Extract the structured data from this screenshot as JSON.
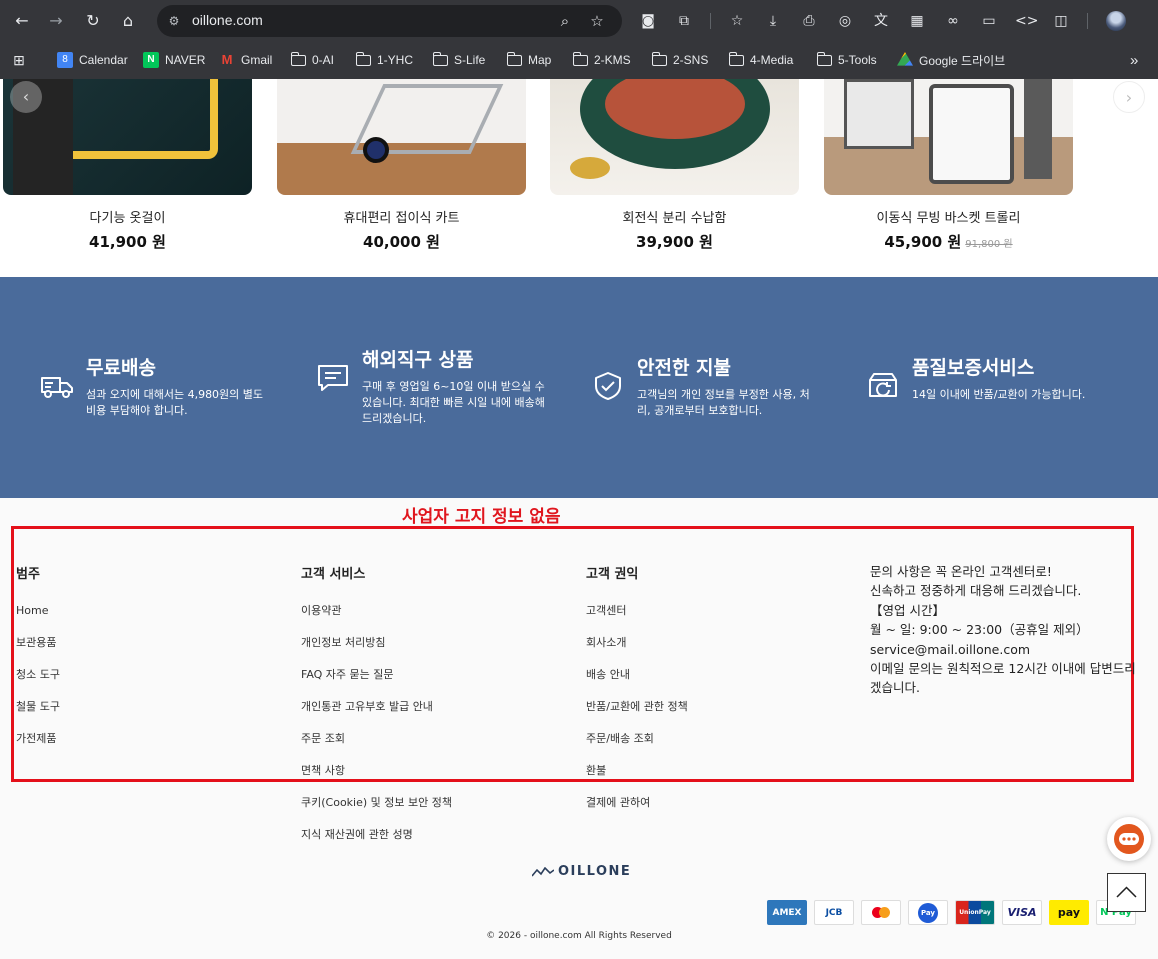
{
  "browser": {
    "url": "oillone.com",
    "bookmarks": [
      "Calendar",
      "NAVER",
      "Gmail",
      "0-AI",
      "1-YHC",
      "S-Life",
      "Map",
      "2-KMS",
      "2-SNS",
      "4-Media",
      "5-Tools",
      "Google 드라이브"
    ],
    "calendar_day": "8",
    "naver_letter": "N",
    "gmail_letter": "M"
  },
  "products": [
    {
      "name": "다기능 옷걸이",
      "price": "41,900 원",
      "old_price": ""
    },
    {
      "name": "휴대편리 접이식 카트",
      "price": "40,000 원",
      "old_price": ""
    },
    {
      "name": "회전식 분리 수납함",
      "price": "39,900 원",
      "old_price": ""
    },
    {
      "name": "이동식 무빙 바스켓 트롤리",
      "price": "45,900 원",
      "old_price": "91,800 원"
    }
  ],
  "features": [
    {
      "title": "무료배송",
      "desc": "섬과 오지에 대해서는 4,980원의 별도 비용 부담해야 합니다.",
      "icon": "truck-icon"
    },
    {
      "title": "해외직구 상품",
      "desc": "구매 후 영업일 6~10일 이내 받으실 수 있습니다. 최대한 빠른 시일 내에 배송해 드리겠습니다.",
      "icon": "chat-icon"
    },
    {
      "title": "안전한 지불",
      "desc": "고객님의 개인 정보를 부정한 사용, 처리, 공개로부터 보호합니다.",
      "icon": "shield-check-icon"
    },
    {
      "title": "품질보증서비스",
      "desc": "14일 이내에 반품/교환이 가능합니다.",
      "icon": "return-box-icon"
    }
  ],
  "annotation": "사업자 고지 정보 없음",
  "footer": {
    "columns": [
      {
        "heading": "범주",
        "links": [
          "Home",
          "보관용품",
          "청소 도구",
          "철물 도구",
          "가전제품"
        ]
      },
      {
        "heading": "고객 서비스",
        "links": [
          "이용약관",
          "개인정보 처리방침",
          "FAQ 자주 묻는 질문",
          "개인통관 고유부호 발급 안내",
          "주문 조회",
          "면책 사항",
          "쿠키(Cookie) 및 정보 보안 정책",
          "지식 재산권에 관한 성명"
        ]
      },
      {
        "heading": "고객 권익",
        "links": [
          "고객센터",
          "회사소개",
          "배송 안내",
          "반품/교환에 관한 정책",
          "주문/배송 조회",
          "환불",
          "결제에 관하여"
        ]
      }
    ],
    "contact": [
      "문의 사항은 꼭 온라인 고객센터로!",
      "신속하고 정중하게 대응해 드리겠습니다.",
      "【영업 시간】",
      "월 ~ 일: 9:00 ~ 23:00（공휴일 제외）",
      "service@mail.oillone.com",
      "이메일 문의는 원칙적으로 12시간 이내에 답변드리겠습니다."
    ],
    "logo_text": "OILLONE",
    "payments": [
      "AMEX",
      "JCB",
      "Mastercard",
      "Pay",
      "UnionPay",
      "VISA",
      "pay",
      "N Pay"
    ],
    "copyright": "© 2026 - oillone.com All Rights Reserved"
  },
  "colors": {
    "feature_band": "#4a6b9b",
    "annotation_red": "#e0161e",
    "browser_bar": "#35363a"
  }
}
